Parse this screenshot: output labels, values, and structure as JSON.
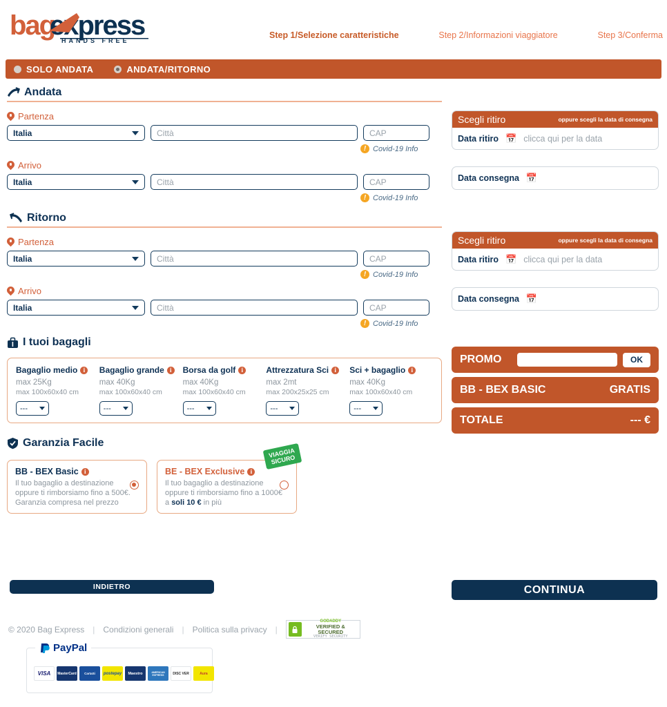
{
  "brand": {
    "name_part1": "bag",
    "name_part2": "ex",
    "name_part3": "press",
    "tagline": "H A N D S   F R E E"
  },
  "steps": [
    {
      "label": "Step 1/Selezione caratteristiche",
      "active": true
    },
    {
      "label": "Step 2/Informazioni viaggiatore",
      "active": false
    },
    {
      "label": "Step 3/Conferma",
      "active": false
    }
  ],
  "trip_type": {
    "options": [
      {
        "label": "SOLO ANDATA",
        "selected": false
      },
      {
        "label": "ANDATA/RITORNO",
        "selected": true
      }
    ]
  },
  "outbound": {
    "title": "Andata",
    "departure": {
      "label": "Partenza",
      "country_value": "Italia",
      "city_placeholder": "Città",
      "zip_placeholder": "CAP",
      "covid_link": "Covid-19 Info"
    },
    "arrival": {
      "label": "Arrivo",
      "country_value": "Italia",
      "city_placeholder": "Città",
      "zip_placeholder": "CAP",
      "covid_link": "Covid-19 Info"
    },
    "pickup": {
      "header": "Scegli ritiro",
      "header_note": "oppure scegli la data di consegna",
      "date_label": "Data ritiro",
      "date_placeholder": "clicca qui per la data",
      "delivery_label": "Data consegna",
      "delivery_value": ""
    }
  },
  "inbound": {
    "title": "Ritorno",
    "departure": {
      "label": "Partenza",
      "country_value": "Italia",
      "city_placeholder": "Città",
      "zip_placeholder": "CAP",
      "covid_link": "Covid-19 Info"
    },
    "arrival": {
      "label": "Arrivo",
      "country_value": "Italia",
      "city_placeholder": "Città",
      "zip_placeholder": "CAP",
      "covid_link": "Covid-19 Info"
    },
    "pickup": {
      "header": "Scegli ritiro",
      "header_note": "oppure scegli la data di consegna",
      "date_label": "Data ritiro",
      "date_placeholder": "clicca qui per la data",
      "delivery_label": "Data consegna",
      "delivery_value": ""
    }
  },
  "baggage": {
    "title": "I tuoi bagagli",
    "items": [
      {
        "name": "Bagaglio medio",
        "weight": "max 25Kg",
        "size": "max 100x60x40 cm",
        "qty": "---"
      },
      {
        "name": "Bagaglio grande",
        "weight": "max 40Kg",
        "size": "max 100x60x40 cm",
        "qty": "---"
      },
      {
        "name": "Borsa da golf",
        "weight": "max 40Kg",
        "size": "max 100x60x40 cm",
        "qty": "---"
      },
      {
        "name": "Attrezzatura Sci",
        "weight": "max 2mt",
        "size": "max 200x25x25 cm",
        "qty": "---"
      },
      {
        "name": "Sci + bagaglio",
        "weight": "max 40Kg",
        "size": "max 100x60x40 cm",
        "qty": "---"
      }
    ]
  },
  "pricing": {
    "promo_label": "PROMO",
    "promo_value": "",
    "promo_button": "OK",
    "plan_label": "BB - BEX BASIC",
    "plan_value": "GRATIS",
    "total_label": "TOTALE",
    "total_value": "--- €"
  },
  "guarantee": {
    "title": "Garanzia Facile",
    "badge": {
      "line1": "VIAGGIA",
      "line2": "SICURO"
    },
    "options": [
      {
        "name": "BB - BEX Basic",
        "line1": "Il tuo bagaglio a destinazione",
        "line2": "oppure ti rimborsiamo fino a 500€.",
        "line3": "Garanzia compresa nel prezzo",
        "selected": true
      },
      {
        "name": "BE - BEX Exclusive",
        "line1": "Il tuo bagaglio a destinazione",
        "line2": "oppure ti rimborsiamo fino a 1000€",
        "line3_pre": "a ",
        "line3_b": "soli 10 €",
        "line3_post": " in più",
        "selected": false
      }
    ]
  },
  "actions": {
    "back": "INDIETRO",
    "next": "CONTINUA"
  },
  "footer": {
    "copyright": "© 2020 Bag Express",
    "sep": "|",
    "terms": "Condizioni generali",
    "privacy": "Politica sulla privacy",
    "seal": {
      "brand": "GODADDY",
      "main": "VERIFIED & SECURED",
      "sub": "VERIFY SECURITY"
    }
  },
  "payments": {
    "provider": "PayPal",
    "cards": [
      "VISA",
      "MasterCard",
      "CartaSi",
      "postepay",
      "Maestro",
      "AMERICAN EXPRESS",
      "DISC VER",
      "Aura"
    ]
  },
  "colors": {
    "orange": "#c1562a",
    "navy": "#0d3151",
    "link": "#d2603a",
    "green": "#2fa84f"
  }
}
